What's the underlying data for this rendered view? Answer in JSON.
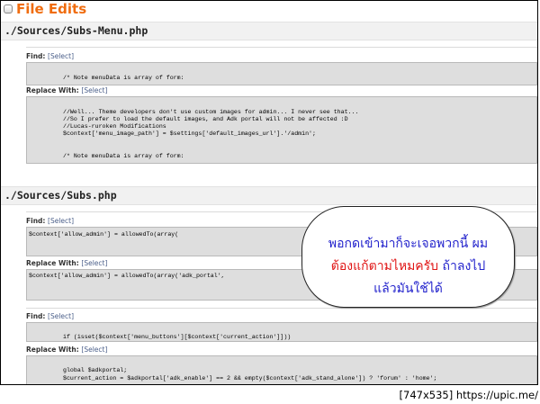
{
  "page": {
    "title": "File Edits"
  },
  "files": [
    {
      "path": "./Sources/Subs-Menu.php",
      "blocks": [
        {
          "label": "Find:",
          "link": "[Select]",
          "lines": [
            "/* Note menuData is array of form:"
          ]
        },
        {
          "label": "Replace With:",
          "link": "[Select]",
          "lines": [
            "//Well... Theme developers don't use custom images for admin... I never see that...",
            "//So I prefer to load the default images, and Adk portal will not be affected :D",
            "//Lucas-ruroken Modifications",
            "$context['menu_image_path'] = $settings['default_images_url'].'/admin';",
            "/* Note menuData is array of form:"
          ]
        }
      ]
    },
    {
      "path": "./Sources/Subs.php",
      "blocks": [
        {
          "label": "Find:",
          "link": "[Select]",
          "lines": [
            "$context['allow_admin'] = allowedTo(array("
          ]
        },
        {
          "label": "Replace With:",
          "link": "[Select]",
          "lines": [
            "$context['allow_admin'] = allowedTo(array('adk_portal',"
          ]
        },
        {
          "label": "Find:",
          "link": "[Select]",
          "lines": [
            "if (isset($context['menu_buttons'][$context['current_action']]))"
          ]
        },
        {
          "label": "Replace With:",
          "link": "[Select]",
          "lines": [
            "global $adkportal;",
            "$current_action = $adkportal['adk_enable'] == 2 && empty($context['adk_stand_alone']) ? 'forum' : 'home';"
          ]
        }
      ]
    }
  ],
  "overlay": {
    "line1": "พอกดเข้ามาก็จะเจอพวกนี้ ผม",
    "line2_red": "ต้องแก้ตามไหมครับ",
    "line2_blue": " ถ้าลงไป",
    "line3": "แล้วมันใช้ได้",
    "colors": {
      "blue": "#2222cc",
      "red": "#e01515"
    }
  },
  "watermark": "[747x535] https://upic.me/"
}
